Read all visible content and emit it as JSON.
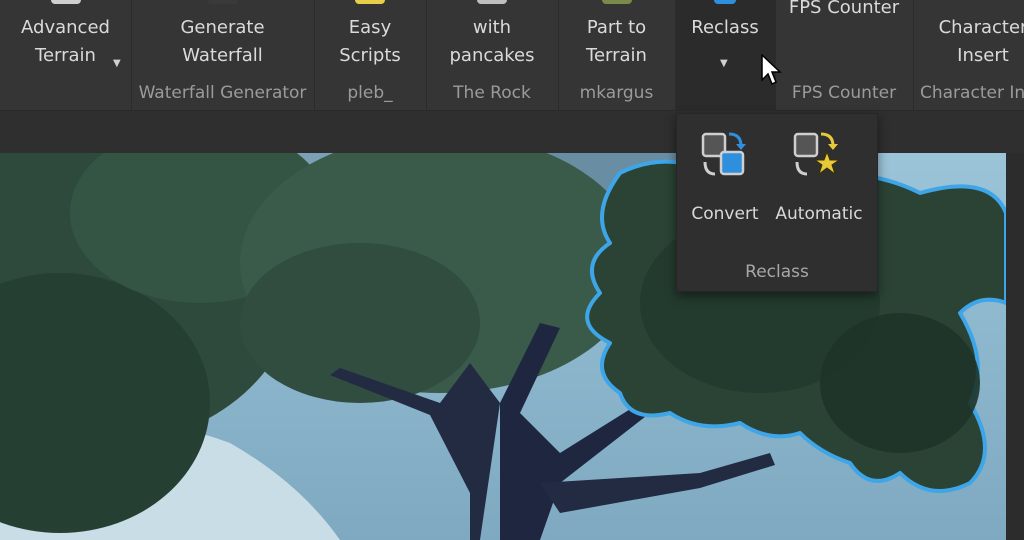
{
  "ribbon": {
    "groups": [
      {
        "button": "Advanced\nTerrain",
        "label": ""
      },
      {
        "button": "Generate\nWaterfall",
        "label": "Waterfall Generator"
      },
      {
        "button": "Easy\nScripts",
        "label": "pleb_"
      },
      {
        "button": "with\npancakes",
        "label": "The Rock"
      },
      {
        "button": "Part to\nTerrain",
        "label": "mkargus"
      },
      {
        "button": "Reclass",
        "label": ""
      },
      {
        "button": "FPS Counter",
        "label": "FPS Counter"
      },
      {
        "button": "Character\nInsert",
        "label": "Character Insert"
      }
    ]
  },
  "dropdown": {
    "items": [
      {
        "label": "Convert",
        "icon": "convert-icon"
      },
      {
        "label": "Automatic",
        "icon": "automatic-icon"
      }
    ],
    "group_label": "Reclass"
  },
  "colors": {
    "selection_outline": "#3ea6e8",
    "star": "#e8c93a",
    "accent_blue": "#2f8fdd"
  }
}
